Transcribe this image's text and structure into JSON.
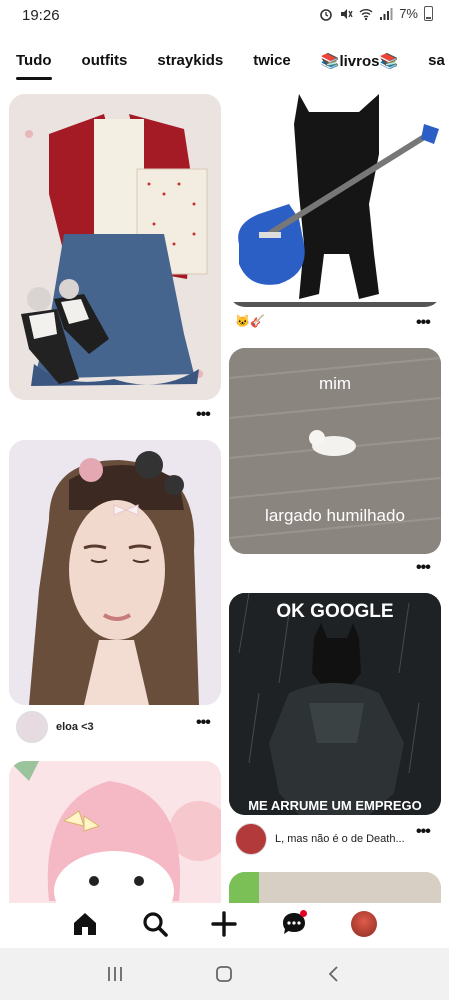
{
  "status": {
    "time": "19:26",
    "battery": "7%"
  },
  "tabs": [
    {
      "label": "Tudo",
      "active": true
    },
    {
      "label": "outfits"
    },
    {
      "label": "straykids"
    },
    {
      "label": "twice"
    },
    {
      "label": "📚livros📚"
    },
    {
      "label": "sa"
    }
  ],
  "pins": {
    "outfit": {
      "image": "outfit-photo"
    },
    "cat_guitar": {
      "image": "black-cat-with-guitar",
      "caption": "🐱🎸"
    },
    "mim": {
      "top_text": "mim",
      "bottom_text": "largado humilhado"
    },
    "girl": {
      "image": "girl-portrait",
      "user": "eloa <3"
    },
    "batman": {
      "top_text": "OK GOOGLE",
      "bottom_text": "ME ARRUME UM EMPREGO",
      "user": "L, mas não é o de Death..."
    },
    "melody": {
      "image": "my-melody-illustration"
    }
  },
  "more_label": "•••",
  "nav": {
    "home": "home-icon",
    "search": "search-icon",
    "create": "plus-icon",
    "messages": "chat-icon",
    "profile": "profile-avatar"
  },
  "colors": {
    "accent": "#e60023",
    "text": "#111111"
  }
}
